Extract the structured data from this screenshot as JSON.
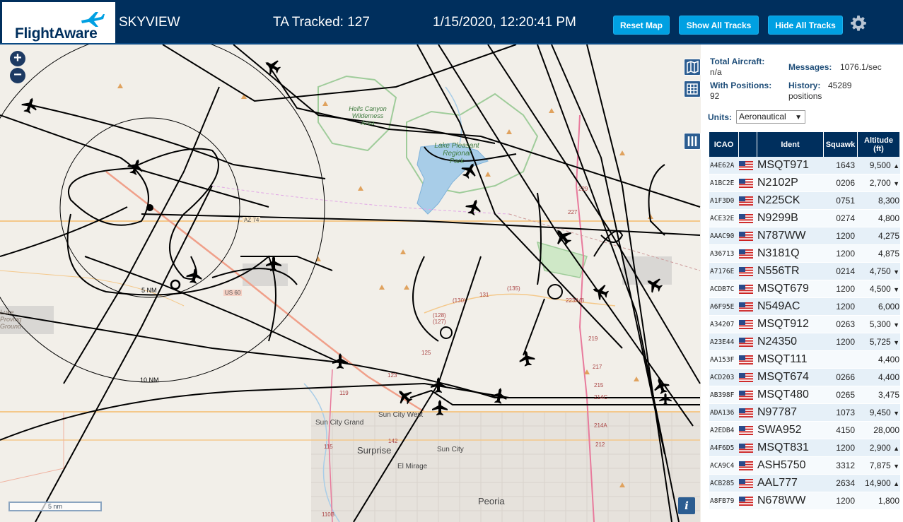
{
  "header": {
    "logo_text": "FlightAware",
    "title": "SKYVIEW",
    "ta_tracked": "TA Tracked: 127",
    "datetime": "1/15/2020, 12:20:41 PM",
    "buttons": {
      "reset": "Reset Map",
      "show_all": "Show All Tracks",
      "hide_all": "Hide All Tracks"
    },
    "icons": {
      "settings": "gear-icon",
      "logo": "airplane-icon"
    }
  },
  "map": {
    "zoom_in": "+",
    "zoom_out": "−",
    "scale_label": "5 nm",
    "range_ring_labels": [
      "5 NM",
      "10 NM"
    ],
    "place_labels": {
      "hells_canyon": [
        "Hells Canyon",
        "Wilderness",
        "Area"
      ],
      "lake_pleasant": [
        "Lake Pleasant",
        "Regional",
        "Park"
      ],
      "sun_city_grand": "Sun City Grand",
      "sun_city_west": "Sun City West",
      "surprise": "Surprise",
      "sun_city": "Sun City",
      "el_mirage": "El Mirage",
      "peoria": "Peoria",
      "luke": [
        "Luke",
        "Proving",
        "Ground"
      ]
    },
    "road_labels": [
      "AZ 74",
      "US 60",
      "(130)",
      "(135)",
      "(128)",
      "(127)",
      "131",
      "123",
      "125",
      "119",
      "142",
      "115",
      "110B",
      "229",
      "227",
      "223A/B",
      "219",
      "217",
      "215",
      "214C",
      "214A",
      "212"
    ],
    "tools": {
      "layers": "map-layers-icon",
      "grid": "grid-icon",
      "columns": "columns-icon",
      "info": "i"
    }
  },
  "sidebar": {
    "total_aircraft_label": "Total Aircraft:",
    "total_aircraft_value": "n/a",
    "with_positions_label": "With Positions:",
    "with_positions_value": "92",
    "messages_label": "Messages:",
    "messages_value": "1076.1/sec",
    "history_label": "History:",
    "history_value": "45289",
    "history_unit": "positions",
    "units_label": "Units:",
    "units_value": "Aeronautical",
    "columns": [
      "ICAO",
      "",
      "Ident",
      "Squawk",
      "Altitude (ft)"
    ],
    "rows": [
      {
        "icao": "A4E62A",
        "ident": "MSQT971",
        "squawk": "1643",
        "alt": "9,500",
        "trend": "▲"
      },
      {
        "icao": "A1BC2E",
        "ident": "N2102P",
        "squawk": "0206",
        "alt": "2,700",
        "trend": "▼"
      },
      {
        "icao": "A1F3D0",
        "ident": "N225CK",
        "squawk": "0751",
        "alt": "8,300",
        "trend": ""
      },
      {
        "icao": "ACE32E",
        "ident": "N9299B",
        "squawk": "0274",
        "alt": "4,800",
        "trend": ""
      },
      {
        "icao": "AAAC90",
        "ident": "N787WW",
        "squawk": "1200",
        "alt": "4,275",
        "trend": ""
      },
      {
        "icao": "A36713",
        "ident": "N3181Q",
        "squawk": "1200",
        "alt": "4,875",
        "trend": ""
      },
      {
        "icao": "A7176E",
        "ident": "N556TR",
        "squawk": "0214",
        "alt": "4,750",
        "trend": "▼"
      },
      {
        "icao": "ACDB7C",
        "ident": "MSQT679",
        "squawk": "1200",
        "alt": "4,500",
        "trend": "▼"
      },
      {
        "icao": "A6F95E",
        "ident": "N549AC",
        "squawk": "1200",
        "alt": "6,000",
        "trend": ""
      },
      {
        "icao": "A34207",
        "ident": "MSQT912",
        "squawk": "0263",
        "alt": "5,300",
        "trend": "▼"
      },
      {
        "icao": "A23E44",
        "ident": "N24350",
        "squawk": "1200",
        "alt": "5,725",
        "trend": "▼"
      },
      {
        "icao": "AA153F",
        "ident": "MSQT111",
        "squawk": "",
        "alt": "4,400",
        "trend": ""
      },
      {
        "icao": "ACD203",
        "ident": "MSQT674",
        "squawk": "0266",
        "alt": "4,400",
        "trend": ""
      },
      {
        "icao": "AB398F",
        "ident": "MSQT480",
        "squawk": "0265",
        "alt": "3,475",
        "trend": ""
      },
      {
        "icao": "ADA136",
        "ident": "N97787",
        "squawk": "1073",
        "alt": "9,450",
        "trend": "▼"
      },
      {
        "icao": "A2EDB4",
        "ident": "SWA952",
        "squawk": "4150",
        "alt": "28,000",
        "trend": ""
      },
      {
        "icao": "A4F6D5",
        "ident": "MSQT831",
        "squawk": "1200",
        "alt": "2,900",
        "trend": "▲"
      },
      {
        "icao": "ACA9C4",
        "ident": "ASH5750",
        "squawk": "3312",
        "alt": "7,875",
        "trend": "▼"
      },
      {
        "icao": "ACB285",
        "ident": "AAL777",
        "squawk": "2634",
        "alt": "14,900",
        "trend": "▲"
      },
      {
        "icao": "A8FB79",
        "ident": "N678WW",
        "squawk": "1200",
        "alt": "1,800",
        "trend": ""
      }
    ]
  }
}
